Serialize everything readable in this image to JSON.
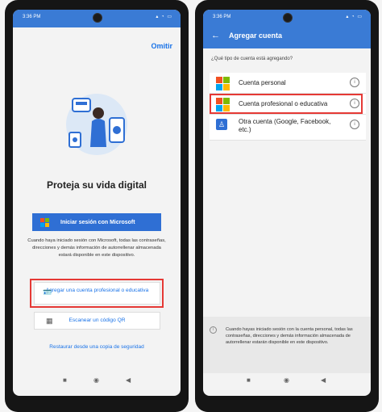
{
  "left": {
    "status_time": "3:36 PM",
    "skip": "Omitir",
    "headline": "Proteja su vida digital",
    "signin_button": "Iniciar sesión con Microsoft",
    "description": "Cuando haya iniciado sesión con Microsoft, todas las contraseñas, direcciones y demás información de autorrellenar almacenada estará disponible en este dispositivo.",
    "add_work_account": "Agregar una cuenta profesional o educativa",
    "scan_qr": "Escanear un código QR",
    "restore": "Restaurar desde una copia de seguridad"
  },
  "right": {
    "status_time": "3:36 PM",
    "title": "Agregar cuenta",
    "question": "¿Qué tipo de cuenta está agregando?",
    "accounts": [
      {
        "label": "Cuenta personal"
      },
      {
        "label": "Cuenta profesional o educativa"
      },
      {
        "label": "Otra cuenta (Google, Facebook, etc.)"
      }
    ],
    "footer_text": "Cuando hayas iniciado sesión con la cuenta personal, todas las contraseñas, direcciones y demás información almacenada de autorrellenar estarán disponible en este dispositivo."
  },
  "colors": {
    "accent": "#3a7bd5",
    "link": "#1a73e8",
    "highlight": "#e53935",
    "ms_red": "#f25022",
    "ms_green": "#7fba00",
    "ms_blue": "#00a4ef",
    "ms_yellow": "#ffb900"
  }
}
